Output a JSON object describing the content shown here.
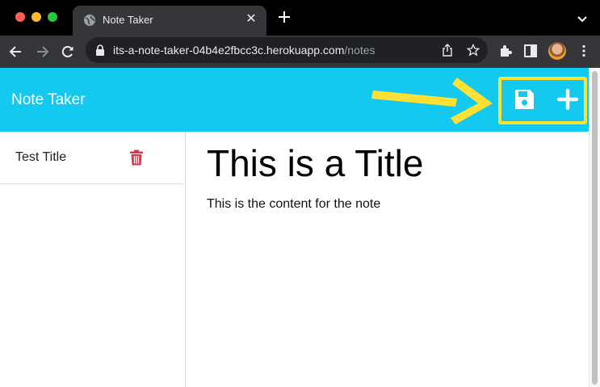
{
  "browser": {
    "tab": {
      "title": "Note Taker",
      "close_glyph": "✕",
      "favicon": "globe-icon"
    },
    "address": {
      "host": "its-a-note-taker-04b4e2fbcc3c.herokuapp.com",
      "path": "/notes"
    }
  },
  "app": {
    "brand": "Note Taker",
    "header_color": "#14c9ef",
    "actions": [
      {
        "name": "save-icon",
        "label": "Save Note"
      },
      {
        "name": "plus-icon",
        "label": "New Note"
      }
    ],
    "highlight_color": "#ffe033",
    "sidebar": {
      "notes": [
        {
          "title": "Test Title",
          "delete_icon": "trash-icon",
          "delete_color": "#dc3545"
        }
      ]
    },
    "editor": {
      "title": "This is a Title",
      "content": "This is the content for the note"
    }
  }
}
